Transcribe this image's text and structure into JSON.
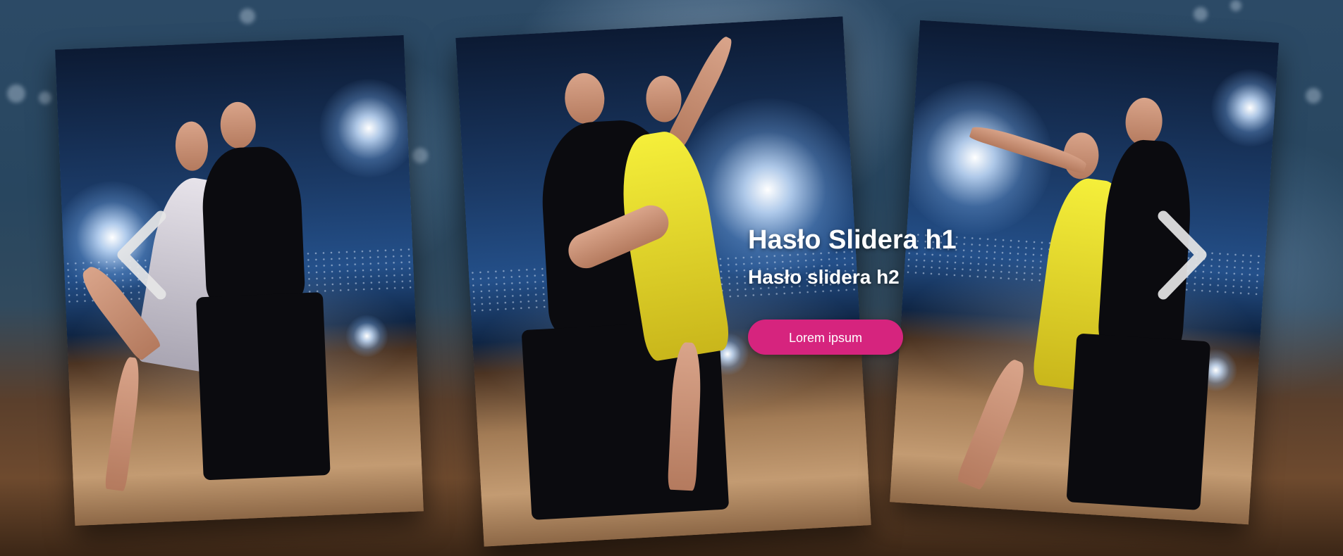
{
  "slider": {
    "heading_h1": "Hasło Slidera h1",
    "heading_h2": "Hasło slidera h2",
    "button_label": "Lorem ipsum",
    "prev_icon": "chevron-left-icon",
    "next_icon": "chevron-right-icon",
    "colors": {
      "accent": "#d6247e",
      "text": "#ffffff",
      "arrow": "#e6e6e6"
    },
    "slides": [
      {
        "name": "dance-couple-silver-dress"
      },
      {
        "name": "dance-couple-yellow-dress"
      },
      {
        "name": "dance-couple-yellow-dress-alt"
      }
    ]
  }
}
